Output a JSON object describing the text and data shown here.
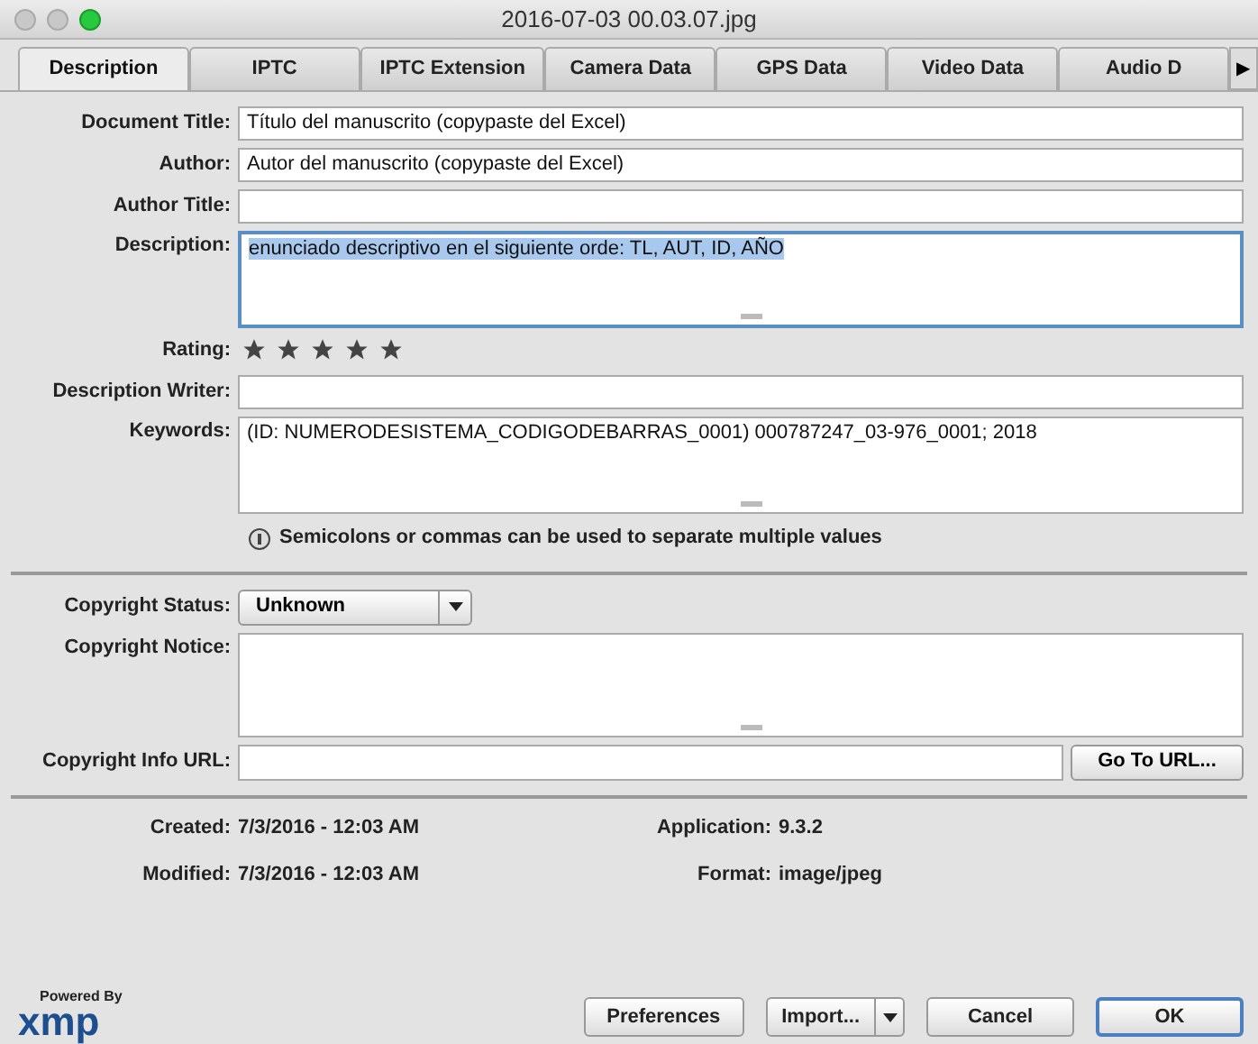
{
  "window": {
    "title": "2016-07-03 00.03.07.jpg"
  },
  "tabs": [
    {
      "label": "Description",
      "selected": true
    },
    {
      "label": "IPTC",
      "selected": false
    },
    {
      "label": "IPTC Extension",
      "selected": false
    },
    {
      "label": "Camera Data",
      "selected": false
    },
    {
      "label": "GPS Data",
      "selected": false
    },
    {
      "label": "Video Data",
      "selected": false
    },
    {
      "label": "Audio D",
      "selected": false
    }
  ],
  "tab_scroll": "▶",
  "fields": [
    {
      "kind": "line",
      "label": "Document Title:",
      "value": "Título del manuscrito (copypaste del Excel)"
    },
    {
      "kind": "line",
      "label": "Author:",
      "value": "Autor del manuscrito (copypaste del Excel)"
    },
    {
      "kind": "line",
      "label": "Author Title:"
    },
    {
      "kind": "area",
      "label": "Description:",
      "value": "enunciado descriptivo en el siguiente orde: TL, AUT, ID, AÑO",
      "focused": true,
      "selected_text": true
    },
    {
      "kind": "rating",
      "label": "Rating:",
      "stars": 5
    },
    {
      "kind": "line",
      "label": "Description Writer:"
    },
    {
      "kind": "area",
      "label": "Keywords:",
      "value": "(ID: NUMERODESISTEMA_CODIGODEBARRAS_0001) 000787247_03-976_0001; 2018",
      "focused": false,
      "selected_text": false
    }
  ],
  "hint": "Semicolons or commas can be used to separate multiple values",
  "copyright": {
    "status_label": "Copyright Status:",
    "status": "Unknown",
    "notice_label": "Copyright Notice:",
    "url_label": "Copyright Info URL:",
    "url_button": "Go To URL..."
  },
  "info": [
    {
      "label": "Created:",
      "value": "7/3/2016 - 12:03 AM"
    },
    {
      "label": "Application:",
      "value": "9.3.2"
    },
    {
      "label": "Modified:",
      "value": "7/3/2016 - 12:03 AM"
    },
    {
      "label": "Format:",
      "value": "image/jpeg"
    }
  ],
  "logo": {
    "caption": "Powered By",
    "name": "xmp"
  },
  "buttons": [
    "Preferences",
    "Import...",
    "Cancel",
    "OK"
  ]
}
